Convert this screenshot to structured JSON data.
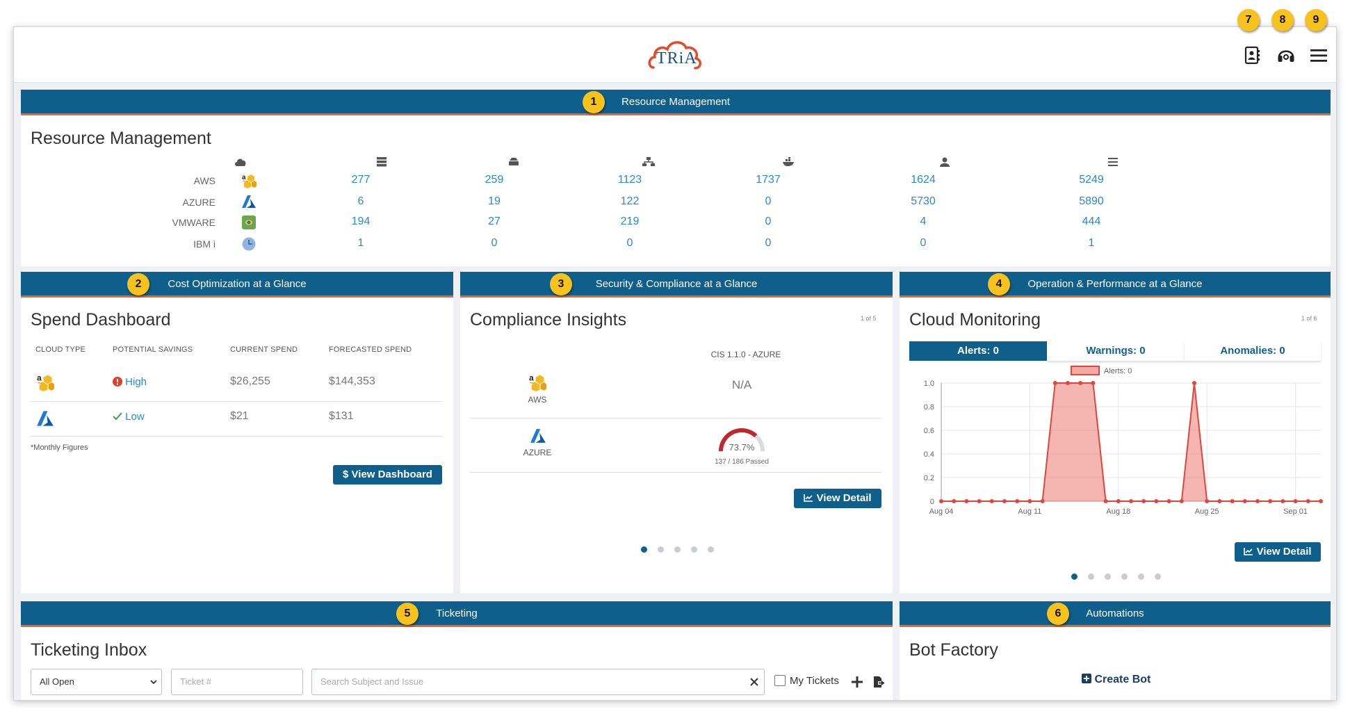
{
  "header": {
    "logo_text": "TRiA",
    "callouts": [
      "7",
      "8",
      "9"
    ],
    "icons": [
      "contacts-icon",
      "support-headset-icon",
      "hamburger-menu-icon"
    ]
  },
  "resource": {
    "callout": "1",
    "bar_title": "Resource Management",
    "title": "Resource Management",
    "column_icons": [
      "cloud-icon",
      "server-icon",
      "drive-icon",
      "network-icon",
      "container-icon",
      "user-icon",
      "list-icon"
    ],
    "rows": [
      {
        "label": "AWS",
        "values": [
          "277",
          "259",
          "1123",
          "1737",
          "1624",
          "5249"
        ]
      },
      {
        "label": "AZURE",
        "values": [
          "6",
          "19",
          "122",
          "0",
          "5730",
          "5890"
        ]
      },
      {
        "label": "VMWARE",
        "values": [
          "194",
          "27",
          "219",
          "0",
          "4",
          "444"
        ]
      },
      {
        "label": "IBM i",
        "values": [
          "1",
          "0",
          "0",
          "0",
          "0",
          "1"
        ]
      }
    ]
  },
  "cost": {
    "callout": "2",
    "bar_title": "Cost Optimization at a Glance",
    "title": "Spend Dashboard",
    "headers": [
      "CLOUD TYPE",
      "POTENTIAL SAVINGS",
      "CURRENT SPEND",
      "FORECASTED SPEND"
    ],
    "rows": [
      {
        "savings": "High",
        "current": "$26,255",
        "forecast": "$144,353"
      },
      {
        "savings": "Low",
        "current": "$21",
        "forecast": "$131"
      }
    ],
    "footnote": "*Monthly Figures",
    "button": "$ View Dashboard"
  },
  "security": {
    "callout": "3",
    "bar_title": "Security & Compliance at a Glance",
    "title": "Compliance Insights",
    "pager": "1 of 5",
    "benchmark": "CIS 1.1.0 - AZURE",
    "aws_label": "AWS",
    "aws_value": "N/A",
    "azure_label": "AZURE",
    "gauge_value": "73.7%",
    "gauge_fraction": 0.737,
    "passed": "137 / 186 Passed",
    "button": "View Detail",
    "dots": 5
  },
  "operations": {
    "callout": "4",
    "bar_title": "Operation & Performance at a Glance",
    "title": "Cloud Monitoring",
    "pager": "1 of 6",
    "tabs": [
      "Alerts: 0",
      "Warnings: 0",
      "Anomalies: 0"
    ],
    "button": "View Detail",
    "dots": 6
  },
  "ticketing": {
    "callout": "5",
    "bar_title": "Ticketing",
    "title": "Ticketing Inbox",
    "filter_value": "All Open",
    "ticket_placeholder": "Ticket #",
    "search_placeholder": "Search Subject and Issue",
    "my_tickets_label": "My Tickets"
  },
  "automations": {
    "callout": "6",
    "bar_title": "Automations",
    "title": "Bot Factory",
    "create_label": "Create Bot"
  },
  "chart_data": {
    "type": "area",
    "legend": "Alerts: 0",
    "x_ticks": [
      "Aug 04",
      "Aug 11",
      "Aug 18",
      "Aug 25",
      "Sep 01"
    ],
    "y_ticks": [
      "0",
      "0.2",
      "0.4",
      "0.6",
      "0.8",
      "1.0"
    ],
    "ylim": [
      0,
      1
    ],
    "series": [
      {
        "name": "Alerts: 0",
        "values": [
          0,
          0,
          0,
          0,
          0,
          0,
          0,
          0,
          0,
          1,
          1,
          1,
          1,
          0,
          0,
          0,
          0,
          0,
          0,
          0,
          1,
          0,
          0,
          0,
          0,
          0,
          0,
          0,
          0,
          0,
          0
        ]
      }
    ]
  }
}
